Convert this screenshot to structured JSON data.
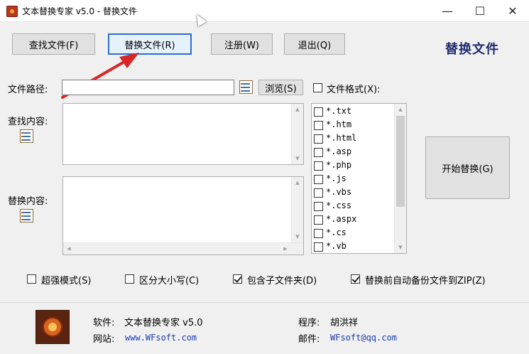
{
  "window": {
    "title": "文本替换专家 v5.0 - 替换文件",
    "min": "—",
    "max": "☐",
    "close": "✕"
  },
  "toolbar": {
    "find_file": "查找文件(F)",
    "replace_file": "替换文件(R)",
    "register": "注册(W)",
    "exit": "退出(Q)",
    "heading": "替换文件"
  },
  "form": {
    "file_path_label": "文件路径:",
    "file_path_value": "",
    "browse": "浏览(S)",
    "file_format_label": "文件格式(X):",
    "find_label": "查找内容:",
    "find_value": "",
    "replace_label": "替换内容:",
    "replace_value": "",
    "start_button": "开始替换(G)"
  },
  "file_types": [
    {
      "label": "*.txt",
      "checked": false
    },
    {
      "label": "*.htm",
      "checked": false
    },
    {
      "label": "*.html",
      "checked": false
    },
    {
      "label": "*.asp",
      "checked": false
    },
    {
      "label": "*.php",
      "checked": false
    },
    {
      "label": "*.js",
      "checked": false
    },
    {
      "label": "*.vbs",
      "checked": false
    },
    {
      "label": "*.css",
      "checked": false
    },
    {
      "label": "*.aspx",
      "checked": false
    },
    {
      "label": "*.cs",
      "checked": false
    },
    {
      "label": "*.vb",
      "checked": false
    }
  ],
  "options": [
    {
      "label": "超强模式(S)",
      "checked": false
    },
    {
      "label": "区分大小写(C)",
      "checked": false
    },
    {
      "label": "包含子文件夹(D)",
      "checked": true
    },
    {
      "label": "替换前自动备份文件到ZIP(Z)",
      "checked": true
    }
  ],
  "footer": {
    "software_label": "软件:",
    "software_value": "文本替换专家 v5.0",
    "website_label": "网站:",
    "website_value": "www.WFsoft.com",
    "author_label": "程序:",
    "author_value": "胡洪祥",
    "email_label": "邮件:",
    "email_value": "WFsoft@qq.com"
  },
  "colors": {
    "heading": "#1f2c6e",
    "annotation_arrow": "#d92525",
    "link": "#1a3ca8"
  }
}
